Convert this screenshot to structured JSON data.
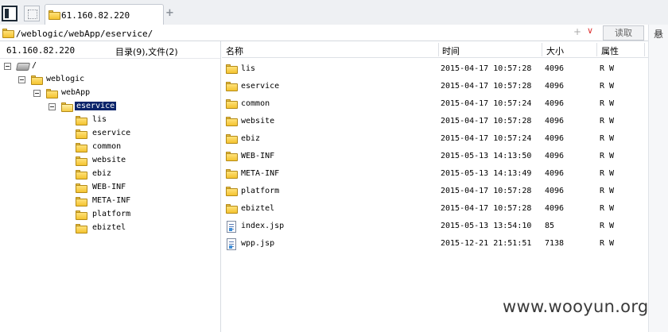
{
  "tab": {
    "title": "61.160.82.220",
    "add_symbol": "+"
  },
  "address": {
    "path": "/weblogic/webApp/eservice/",
    "plus": "+",
    "dropdown": "∨",
    "read_label": "读取"
  },
  "side_glyph": "悬",
  "left_panel": {
    "host": "61.160.82.220",
    "counts": "目录(9),文件(2)"
  },
  "tree": [
    {
      "label": "/",
      "icon": "drive-icon"
    },
    {
      "label": "weblogic",
      "icon": "folder-icon"
    },
    {
      "label": "webApp",
      "icon": "folder-icon"
    },
    {
      "label": "eservice",
      "icon": "folder-open-icon",
      "selected": true
    },
    {
      "label": "lis",
      "icon": "folder-icon"
    },
    {
      "label": "eservice",
      "icon": "folder-icon"
    },
    {
      "label": "common",
      "icon": "folder-icon"
    },
    {
      "label": "website",
      "icon": "folder-icon"
    },
    {
      "label": "ebiz",
      "icon": "folder-icon"
    },
    {
      "label": "WEB-INF",
      "icon": "folder-icon"
    },
    {
      "label": "META-INF",
      "icon": "folder-icon"
    },
    {
      "label": "platform",
      "icon": "folder-icon"
    },
    {
      "label": "ebiztel",
      "icon": "folder-icon"
    }
  ],
  "columns": {
    "name": "名称",
    "time": "时间",
    "size": "大小",
    "attr": "属性"
  },
  "files": [
    {
      "name": "lis",
      "time": "2015-04-17 10:57:28",
      "size": "4096",
      "attr": "R W",
      "type": "folder"
    },
    {
      "name": "eservice",
      "time": "2015-04-17 10:57:28",
      "size": "4096",
      "attr": "R W",
      "type": "folder"
    },
    {
      "name": "common",
      "time": "2015-04-17 10:57:24",
      "size": "4096",
      "attr": "R W",
      "type": "folder"
    },
    {
      "name": "website",
      "time": "2015-04-17 10:57:28",
      "size": "4096",
      "attr": "R W",
      "type": "folder"
    },
    {
      "name": "ebiz",
      "time": "2015-04-17 10:57:24",
      "size": "4096",
      "attr": "R W",
      "type": "folder"
    },
    {
      "name": "WEB-INF",
      "time": "2015-05-13 14:13:50",
      "size": "4096",
      "attr": "R W",
      "type": "folder"
    },
    {
      "name": "META-INF",
      "time": "2015-05-13 14:13:49",
      "size": "4096",
      "attr": "R W",
      "type": "folder"
    },
    {
      "name": "platform",
      "time": "2015-04-17 10:57:28",
      "size": "4096",
      "attr": "R W",
      "type": "folder"
    },
    {
      "name": "ebiztel",
      "time": "2015-04-17 10:57:28",
      "size": "4096",
      "attr": "R W",
      "type": "folder"
    },
    {
      "name": "index.jsp",
      "time": "2015-05-13 13:54:10",
      "size": "85",
      "attr": "R W",
      "type": "file"
    },
    {
      "name": "wpp.jsp",
      "time": "2015-12-21 21:51:51",
      "size": "7138",
      "attr": "R W",
      "type": "file"
    }
  ],
  "watermark": "www.wooyun.org"
}
